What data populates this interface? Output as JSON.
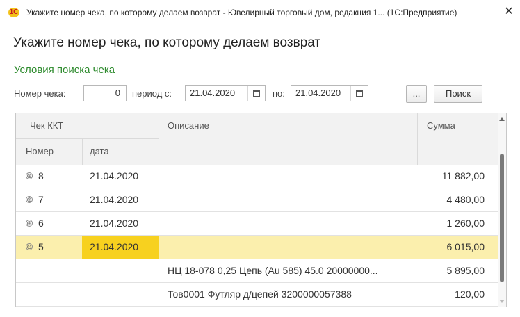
{
  "window": {
    "title": "Укажите номер чека, по которому делаем возврат - Ювелирный торговый дом, редакция 1... (1С:Предприятие)",
    "logo_text": "1С",
    "close_glyph": "✕"
  },
  "page_title": "Укажите номер чека, по которому делаем возврат",
  "search": {
    "section_title": "Условия поиска чека",
    "check_number_label": "Номер чека:",
    "check_number_value": "0",
    "period_from_label": "период с:",
    "period_from_value": "21.04.2020",
    "period_to_label": "по:",
    "period_to_value": "21.04.2020",
    "ellipsis_label": "...",
    "search_button_label": "Поиск"
  },
  "grid": {
    "headers": {
      "group": "Чек ККТ",
      "number": "Номер",
      "date": "дата",
      "description": "Описание",
      "sum": "Сумма"
    },
    "rows": [
      {
        "expander": "⊕",
        "number": "8",
        "date": "21.04.2020",
        "description": "",
        "sum": "11 882,00"
      },
      {
        "expander": "⊕",
        "number": "7",
        "date": "21.04.2020",
        "description": "",
        "sum": "4 480,00"
      },
      {
        "expander": "⊕",
        "number": "6",
        "date": "21.04.2020",
        "description": "",
        "sum": "1 260,00"
      },
      {
        "expander": "⊖",
        "number": "5",
        "date": "21.04.2020",
        "description": "",
        "sum": "6 015,00",
        "selected": true
      },
      {
        "expander": "",
        "number": "",
        "date": "",
        "description": "НЦ 18-078 0,25 Цепь (Au 585) 45.0 20000000...",
        "sum": "5 895,00"
      },
      {
        "expander": "",
        "number": "",
        "date": "",
        "description": "Тов0001 Футляр д/цепей  3200000057388",
        "sum": "120,00"
      }
    ]
  },
  "colors": {
    "section_title": "#2e8b2e",
    "selected_row": "#fbefad",
    "selected_cell": "#f7d11f"
  }
}
